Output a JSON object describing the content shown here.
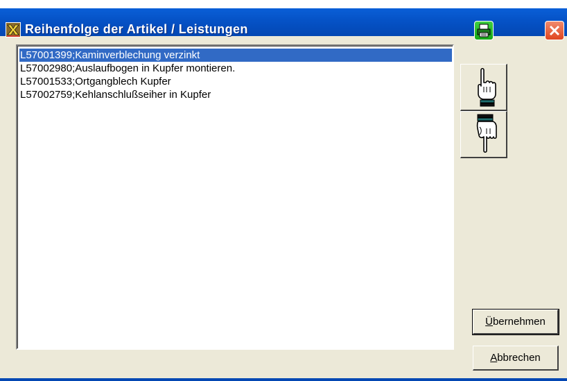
{
  "window": {
    "title": "Reihenfolge der Artikel / Leistungen"
  },
  "list": {
    "items": [
      {
        "label": "L57001399;Kaminverblechung verzinkt",
        "selected": true
      },
      {
        "label": "L57002980;Auslaufbogen in Kupfer montieren.",
        "selected": false
      },
      {
        "label": "L57001533;Ortgangblech Kupfer",
        "selected": false
      },
      {
        "label": "L57002759;Kehlanschlußseiher in Kupfer",
        "selected": false
      }
    ]
  },
  "buttons": {
    "accept": {
      "mnemonic": "Ü",
      "rest": "bernehmen"
    },
    "cancel": {
      "mnemonic": "A",
      "rest": "bbrechen"
    }
  },
  "icons": {
    "app": "app-icon",
    "print": "printer-icon",
    "close": "close-icon",
    "move_up": "hand-pointing-up-icon",
    "move_down": "hand-pointing-down-icon"
  },
  "colors": {
    "titlebar": "#0552c6",
    "selection": "#316ac5",
    "print_button": "#16a816",
    "close_button": "#e0451f"
  }
}
